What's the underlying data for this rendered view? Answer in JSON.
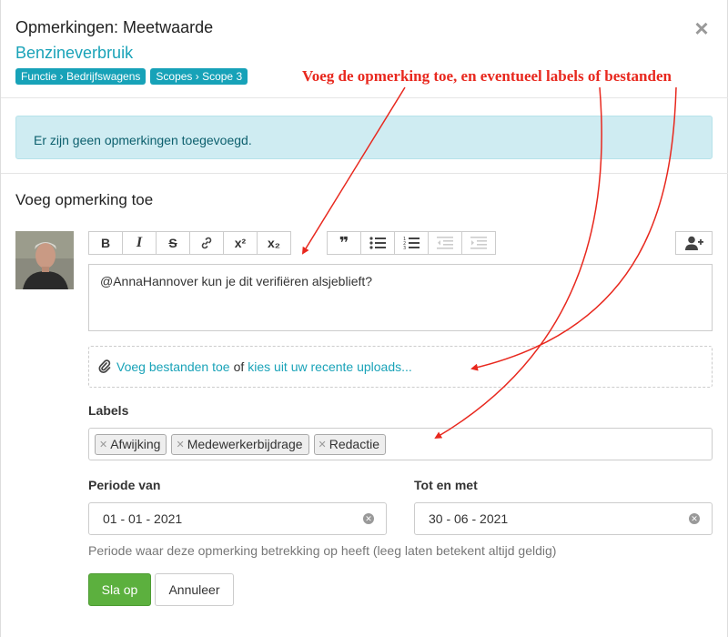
{
  "modal": {
    "title": "Opmerkingen: Meetwaarde",
    "subtitle": "Benzineverbruik",
    "badges": [
      "Functie › Bedrijfswagens",
      "Scopes › Scope 3"
    ],
    "close_label": "×"
  },
  "annotation": "Voeg de opmerking toe, en eventueel labels of bestanden",
  "alert": "Er zijn geen opmerkingen toegevoegd.",
  "section_title": "Voeg opmerking toe",
  "toolbar": {
    "bold": "B",
    "italic": "I",
    "strike": "S",
    "link": "link-icon",
    "superscript": "x²",
    "subscript": "x₂",
    "quote": "❞",
    "bullet_list": "bulleted-list-icon",
    "numbered_list": "numbered-list-icon",
    "outdent": "outdent-icon",
    "indent": "indent-icon",
    "mention": "add-user-icon"
  },
  "editor_text": "@AnnaHannover kun je dit verifiëren alsjeblieft?",
  "attachments": {
    "add_files": "Voeg bestanden toe",
    "or": "of",
    "recent_uploads": "kies uit uw recente uploads..."
  },
  "labels": {
    "title": "Labels",
    "tags": [
      "Afwijking",
      "Medewerkerbijdrage",
      "Redactie"
    ]
  },
  "period": {
    "from_label": "Periode van",
    "from_value": "01 - 01 - 2021",
    "to_label": "Tot en met",
    "to_value": "30 - 06 - 2021",
    "help": "Periode waar deze opmerking betrekking op heeft (leeg laten betekent altijd geldig)"
  },
  "buttons": {
    "save": "Sla op",
    "cancel": "Annuleer"
  },
  "colors": {
    "accent": "#17a2b8",
    "save": "#5cb03e",
    "annotation": "#e8281e",
    "alert_bg": "#cfecf2"
  }
}
